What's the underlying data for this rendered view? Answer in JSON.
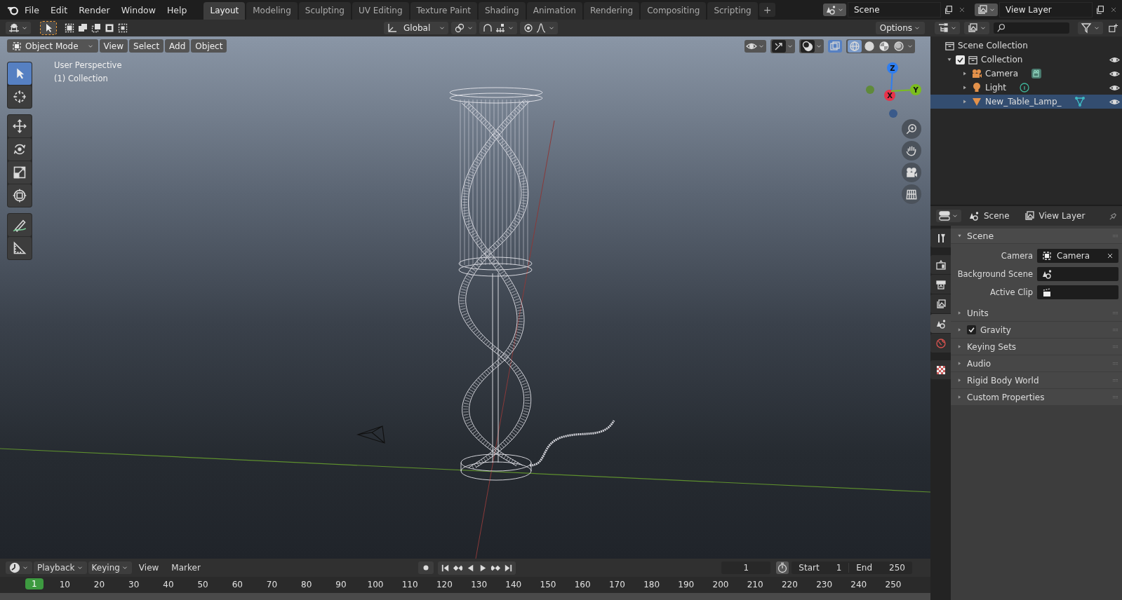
{
  "menu": [
    "File",
    "Edit",
    "Render",
    "Window",
    "Help"
  ],
  "workspace_tabs": [
    {
      "label": "Layout",
      "selected": true
    },
    {
      "label": "Modeling",
      "selected": false
    },
    {
      "label": "Sculpting",
      "selected": false
    },
    {
      "label": "UV Editing",
      "selected": false
    },
    {
      "label": "Texture Paint",
      "selected": false
    },
    {
      "label": "Shading",
      "selected": false
    },
    {
      "label": "Animation",
      "selected": false
    },
    {
      "label": "Rendering",
      "selected": false
    },
    {
      "label": "Compositing",
      "selected": false
    },
    {
      "label": "Scripting",
      "selected": false
    }
  ],
  "add_tab": "+",
  "scene_field": {
    "value": "Scene"
  },
  "view_layer_field": {
    "value": "View Layer"
  },
  "tool_header": {
    "select_modes": [
      {
        "kind": "set"
      },
      {
        "kind": "extend"
      },
      {
        "kind": "subtract"
      },
      {
        "kind": "invert"
      },
      {
        "kind": "intersect"
      }
    ],
    "orientation": "Global",
    "options": "Options"
  },
  "viewport": {
    "mode": "Object Mode",
    "menus": [
      "View",
      "Select",
      "Add",
      "Object"
    ],
    "xray": true,
    "shading": [
      {
        "kind": "wireframe",
        "selected": true
      },
      {
        "kind": "solid",
        "selected": false
      },
      {
        "kind": "material",
        "selected": false
      },
      {
        "kind": "rendered",
        "selected": false
      }
    ],
    "info": [
      "User Perspective",
      "(1) Collection"
    ],
    "toolbar": [
      [
        {
          "kind": "select",
          "selected": true
        },
        {
          "kind": "cursor",
          "selected": false
        }
      ],
      [
        {
          "kind": "move",
          "selected": false
        },
        {
          "kind": "rotate",
          "selected": false
        },
        {
          "kind": "scale",
          "selected": false
        },
        {
          "kind": "transform",
          "selected": false
        }
      ],
      [
        {
          "kind": "annotate",
          "selected": false
        },
        {
          "kind": "measure",
          "selected": false
        }
      ]
    ],
    "gizmo": [
      {
        "label": "Z",
        "color": "#2f7ef0"
      },
      {
        "label": "X",
        "color": "#e8324a"
      },
      {
        "label": "Y",
        "color": "#7bbd1e"
      }
    ],
    "nav_buttons": [
      {
        "kind": "zoom"
      },
      {
        "kind": "pan"
      },
      {
        "kind": "camera"
      },
      {
        "kind": "ortho"
      }
    ]
  },
  "outliner": {
    "root": "Scene Collection",
    "collections": [
      {
        "label": "Collection",
        "checked": true,
        "expanded": true,
        "visible": true,
        "children": [
          {
            "label": "Camera",
            "kind": "camera",
            "expanded": false,
            "selected": false,
            "visible": true
          },
          {
            "label": "Light",
            "kind": "light",
            "expanded": false,
            "selected": false,
            "visible": true
          },
          {
            "label": "New_Table_Lamp_",
            "kind": "mesh",
            "expanded": false,
            "selected": true,
            "visible": true
          }
        ]
      }
    ]
  },
  "properties": {
    "header": [
      {
        "kind": "scene",
        "label": "Scene"
      },
      {
        "kind": "view_layer",
        "label": "View Layer"
      }
    ],
    "tabs": [
      {
        "kind": "tool",
        "selected": false
      },
      {
        "kind": "render",
        "selected": false
      },
      {
        "kind": "output",
        "selected": false
      },
      {
        "kind": "view_layer",
        "selected": false
      },
      {
        "kind": "scene",
        "selected": true
      },
      {
        "kind": "world",
        "selected": false
      },
      {
        "kind": "texture",
        "selected": false
      }
    ],
    "panel": {
      "title": "Scene",
      "expanded": true,
      "fields": [
        {
          "label": "Camera",
          "kind": "camera",
          "value": "Camera"
        },
        {
          "label": "Background Scene",
          "kind": "scene"
        },
        {
          "label": "Active Clip",
          "kind": "clip"
        }
      ]
    },
    "sections": [
      {
        "label": "Units",
        "kind": "plain",
        "expanded": false
      },
      {
        "label": "Gravity",
        "kind": "checkbox",
        "checked": true,
        "expanded": false
      },
      {
        "label": "Keying Sets",
        "kind": "plain",
        "expanded": false
      },
      {
        "label": "Audio",
        "kind": "plain",
        "expanded": false
      },
      {
        "label": "Rigid Body World",
        "kind": "plain",
        "expanded": false
      },
      {
        "label": "Custom Properties",
        "kind": "plain",
        "expanded": false
      }
    ]
  },
  "timeline": {
    "menus": [
      {
        "label": "Playback",
        "kind": "dropdown"
      },
      {
        "label": "Keying",
        "kind": "dropdown"
      },
      {
        "label": "View",
        "kind": "menu"
      },
      {
        "label": "Marker",
        "kind": "menu"
      }
    ],
    "transport": [
      {
        "kind": "jump_start"
      },
      {
        "kind": "prev_key"
      },
      {
        "kind": "play_reverse"
      },
      {
        "kind": "play"
      },
      {
        "kind": "next_key"
      },
      {
        "kind": "jump_end"
      }
    ],
    "current_frame": "1",
    "start_label": "Start",
    "start": "1",
    "end_label": "End",
    "end": "250",
    "marker": "1",
    "ticks": [
      "10",
      "20",
      "30",
      "40",
      "50",
      "60",
      "70",
      "80",
      "90",
      "100",
      "110",
      "120",
      "130",
      "140",
      "150",
      "160",
      "170",
      "180",
      "190",
      "200",
      "210",
      "220",
      "230",
      "240",
      "250"
    ]
  }
}
